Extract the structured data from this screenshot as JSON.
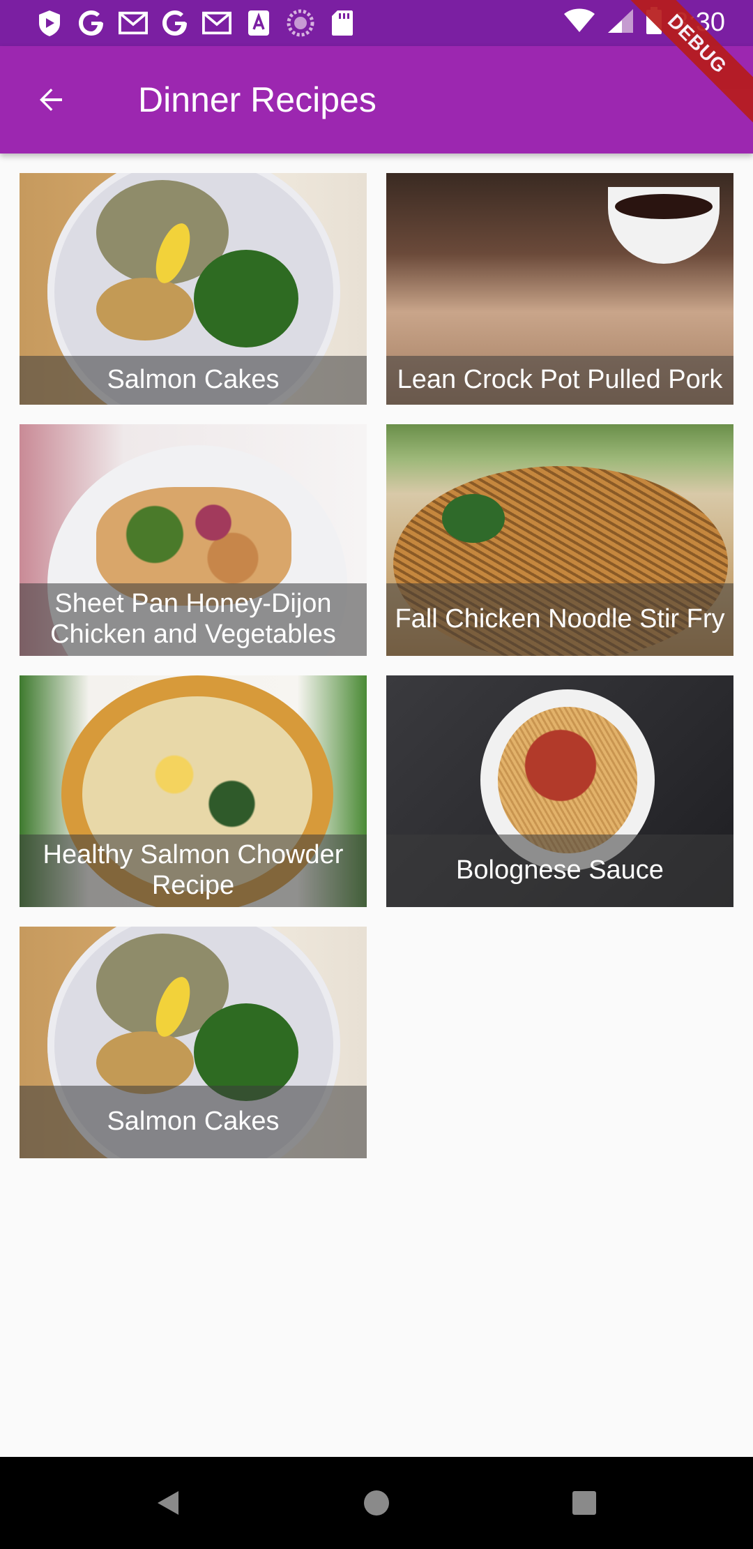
{
  "status_bar": {
    "time": "3:30",
    "left_icons": [
      "shield-app-icon",
      "google-g-icon",
      "gmail-icon",
      "google-g-icon",
      "gmail-icon",
      "a-notification-icon",
      "circle-progress-icon",
      "sd-card-icon"
    ],
    "right_icons": [
      "wifi-icon",
      "cell-signal-icon",
      "battery-icon"
    ],
    "debug_ribbon": "DEBUG"
  },
  "app_bar": {
    "title": "Dinner Recipes",
    "back_icon": "arrow-back-icon",
    "background": "#9c27b0",
    "status_background": "#7b1fa2"
  },
  "recipes": [
    {
      "title": "Salmon Cakes"
    },
    {
      "title": "Lean Crock Pot Pulled Pork"
    },
    {
      "title": "Sheet Pan Honey-Dijon Chicken and Vegetables"
    },
    {
      "title": "Fall Chicken Noodle Stir Fry"
    },
    {
      "title": "Healthy Salmon Chowder Recipe"
    },
    {
      "title": "Bolognese Sauce"
    },
    {
      "title": "Salmon Cakes"
    }
  ],
  "nav_bar": {
    "icons": [
      "back-triangle-icon",
      "home-circle-icon",
      "recents-square-icon"
    ]
  }
}
